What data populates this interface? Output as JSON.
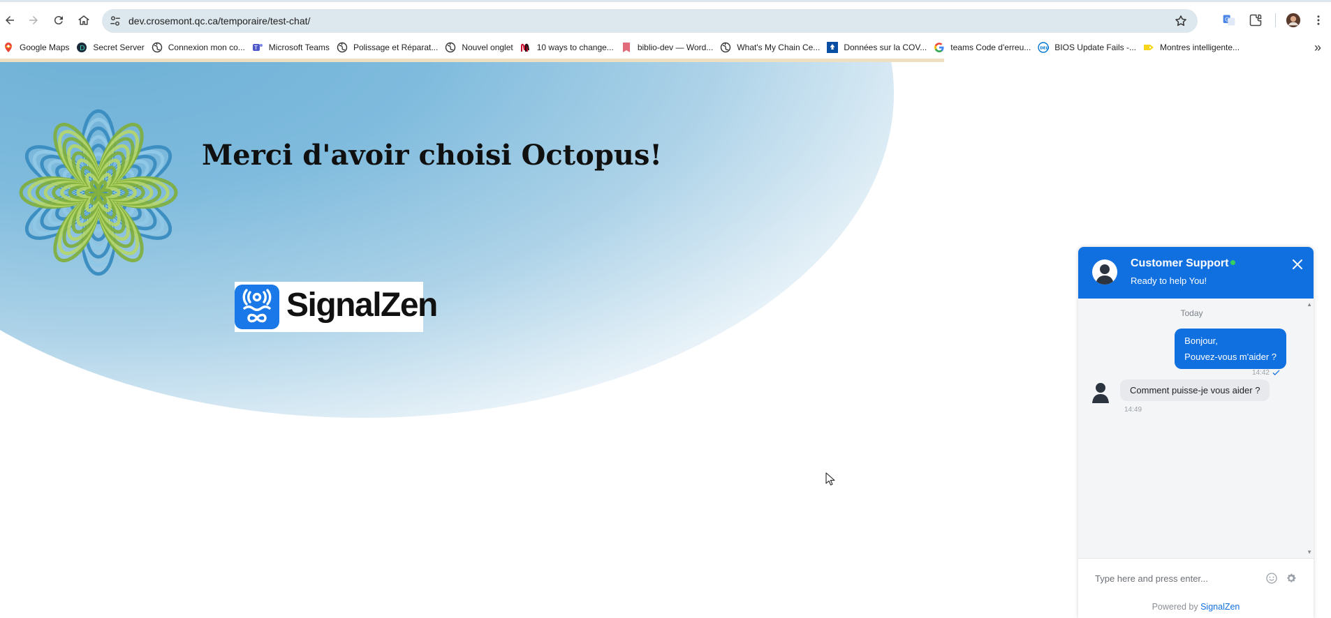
{
  "browser": {
    "url": "dev.crosemont.qc.ca/temporaire/test-chat/",
    "icons": [
      "back-icon",
      "forward-icon",
      "reload-icon",
      "home-icon",
      "site-info-icon",
      "bookmark-star-icon",
      "translate-icon",
      "extensions-icon",
      "profile-avatar",
      "menu-icon"
    ]
  },
  "bookmarks": [
    {
      "label": "Google Maps",
      "icon": "google-maps-icon"
    },
    {
      "label": "Secret Server",
      "icon": "secret-server-icon"
    },
    {
      "label": "Connexion mon co...",
      "icon": "globe-icon"
    },
    {
      "label": "Microsoft Teams",
      "icon": "teams-icon"
    },
    {
      "label": "Polissage et Réparat...",
      "icon": "globe-icon"
    },
    {
      "label": "Nouvel onglet",
      "icon": "globe-icon"
    },
    {
      "label": "10 ways to change...",
      "icon": "mcdonalds-icon"
    },
    {
      "label": "biblio-dev — Word...",
      "icon": "wordpress-icon"
    },
    {
      "label": "What's My Chain Ce...",
      "icon": "globe-icon"
    },
    {
      "label": "Données sur la COV...",
      "icon": "quebec-icon"
    },
    {
      "label": "teams Code d'erreu...",
      "icon": "google-icon"
    },
    {
      "label": "BIOS Update Fails -...",
      "icon": "dell-icon"
    },
    {
      "label": "Montres intelligente...",
      "icon": "tag-icon"
    }
  ],
  "bookmarks_more": "»",
  "page": {
    "headline": "Merci d'avoir choisi Octopus!",
    "logo_text": "SignalZen"
  },
  "chat": {
    "title": "Customer Support",
    "subtitle": "Ready to help You!",
    "status_color": "#35d15a",
    "accent": "#1170e0",
    "day_label": "Today",
    "messages": [
      {
        "direction": "out",
        "lines": [
          "Bonjour,",
          "Pouvez-vous m'aider ?"
        ],
        "time": "14:42",
        "read": true
      },
      {
        "direction": "in",
        "lines": [
          "Comment puisse-je vous aider ?"
        ],
        "time": "14:49"
      }
    ],
    "input_placeholder": "Type here and press enter...",
    "powered_prefix": "Powered by",
    "powered_brand": "SignalZen"
  }
}
